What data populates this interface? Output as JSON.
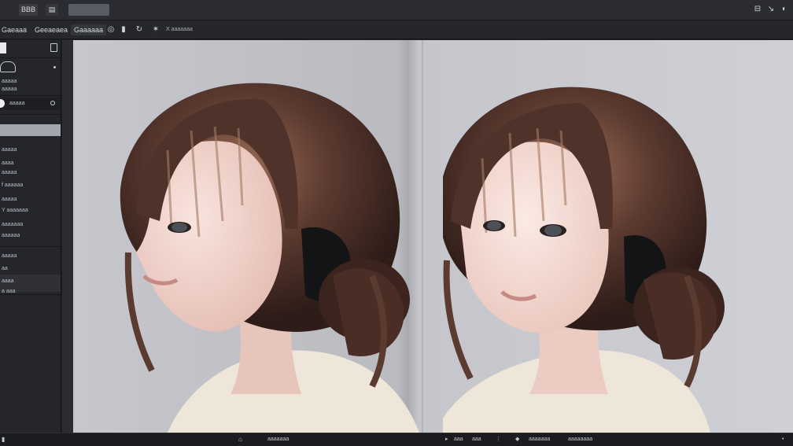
{
  "topbar": {
    "menu_label": "BBB",
    "doc_icon": "document-icon",
    "search_value": "",
    "right_icons": [
      "panel-icon",
      "arrow-icon",
      "headphones-icon"
    ]
  },
  "toolbar": {
    "tab1": "Gaeaaa",
    "tab2": "Geeaeaea",
    "tab3": "Gaaaaaa",
    "info": "X aaaaaaa",
    "icons": [
      "circle-icon",
      "bar-icon",
      "refresh-icon",
      "wand-icon"
    ]
  },
  "sidebar": {
    "rows": [
      "aaaaa",
      "aaaaa",
      "aaaaa",
      "aaaaa",
      "aaaa",
      "aaaaa",
      "f aaaaaa",
      "aaaaa",
      "Y aaaaaaa",
      "aaaaaaa",
      "aaaaaa",
      "aaaaa",
      "aa",
      "aaaa",
      "a aaa"
    ]
  },
  "status": {
    "center1": "aaaaaaa",
    "right1": "aaa",
    "right2": "aaa",
    "right3": "aaaaaaa",
    "right4": "aaaaaaaa"
  },
  "colors": {
    "skin": "#f2d6cf",
    "hair": "#4a3029",
    "hair_highlight": "#9a6b56",
    "sweater": "#efe6da",
    "headphone": "#1a1b1e"
  }
}
